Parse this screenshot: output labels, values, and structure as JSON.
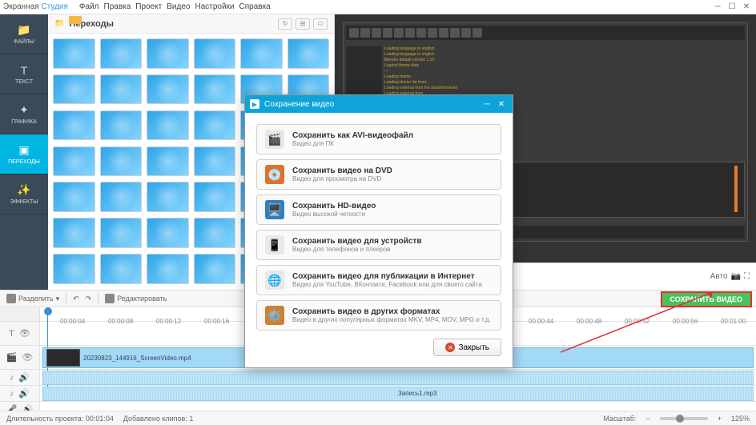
{
  "app": {
    "name1": "Экранная",
    "name2": "Студия"
  },
  "menu": [
    "Файл",
    "Правка",
    "Проект",
    "Видео",
    "Настройки",
    "Справка"
  ],
  "sidebar": [
    {
      "label": "ФАЙЛЫ",
      "icon": "📁"
    },
    {
      "label": "ТЕКСТ",
      "icon": "T"
    },
    {
      "label": "ГРАФИКА",
      "icon": "✦"
    },
    {
      "label": "ПЕРЕХОДЫ",
      "icon": "▣"
    },
    {
      "label": "ЭФФЕКТЫ",
      "icon": "✨"
    }
  ],
  "transitions_title": "Переходы",
  "toolbar": {
    "split": "Разделить",
    "edit": "Редактировать"
  },
  "ruler": [
    "00:00:04",
    "00:00:08",
    "00:00:12",
    "00:00:16",
    "00:00:44",
    "00:00:48",
    "00:00:52",
    "00:00:56",
    "00:01:00"
  ],
  "clip": {
    "name": "20230823_144916_ScreenVideo.mp4"
  },
  "audio": {
    "name": "Запись1.mp3"
  },
  "preview_auto": "Авто",
  "save_video": "СОХРАНИТЬ ВИДЕО",
  "status": {
    "duration_label": "Длительность проекта:",
    "duration_value": "00:01:04",
    "clips_label": "Добавлено клипов:",
    "clips_value": "1",
    "scale_label": "Масштаб:",
    "zoom": "125%"
  },
  "dialog": {
    "title": "Сохранение видео",
    "options": [
      {
        "title": "Сохранить как AVI-видеофайл",
        "sub": "Видео для ПК",
        "icon": "🎬",
        "bg": "#e8e8e8"
      },
      {
        "title": "Сохранить видео на DVD",
        "sub": "Видео для просмотра на DVD",
        "icon": "💿",
        "bg": "#e07030"
      },
      {
        "title": "Сохранить HD-видео",
        "sub": "Видео высокой четкости",
        "icon": "🖥️",
        "bg": "#3080c0"
      },
      {
        "title": "Сохранить видео для устройств",
        "sub": "Видео для телефонов и плееров",
        "icon": "📱",
        "bg": "#e8e8e8"
      },
      {
        "title": "Сохранить видео для публикации в Интернет",
        "sub": "Видео для YouTube, ВКонтакте, Facebook или для своего сайта",
        "icon": "🌐",
        "bg": "#e8e8e8"
      },
      {
        "title": "Сохранить видео в других форматах",
        "sub": "Видео в других популярных форматах MKV, MP4, MOV, MPG и т.д.",
        "icon": "⚙️",
        "bg": "#d08030"
      }
    ],
    "close": "Закрыть"
  }
}
